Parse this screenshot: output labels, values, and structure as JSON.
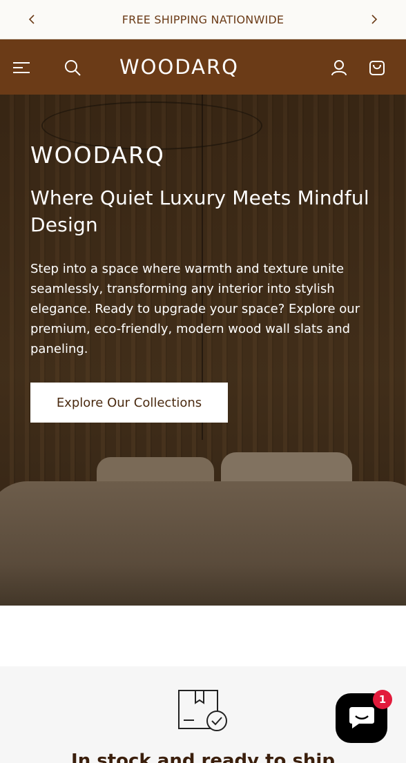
{
  "announcement": {
    "text": "FREE SHIPPING NATIONWIDE"
  },
  "header": {
    "logo_text": "WOODARQ"
  },
  "hero": {
    "logo_text": "WOODARQ",
    "title": "Where Quiet Luxury Meets Mindful Design",
    "description": "Step into a space where warmth and texture unite seamlessly, transforming any interior into stylish elegance. Ready to upgrade your space? Explore our premium, eco-friendly, modern wood wall slats and paneling.",
    "cta_label": "Explore Our Collections"
  },
  "features": {
    "heading": "In stock and ready to ship"
  },
  "chat": {
    "badge_count": "1"
  },
  "colors": {
    "brand": "#6b3b17",
    "announcement_bg": "#fbfaf7",
    "badge": "#e21b3c"
  }
}
